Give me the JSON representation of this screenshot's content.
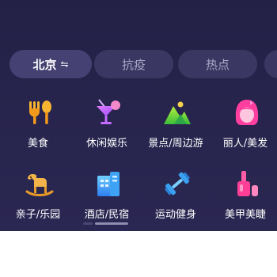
{
  "tabs": [
    {
      "label": "北京",
      "icon": "swap-arrows-icon",
      "arrow": "⇋"
    },
    {
      "label": "抗疫"
    },
    {
      "label": "热点"
    },
    {
      "label": ""
    }
  ],
  "categories": [
    {
      "label": "美食",
      "icon": "fork-spoon-icon"
    },
    {
      "label": "休闲娱乐",
      "icon": "cocktail-icon"
    },
    {
      "label": "景点/周边游",
      "icon": "mountain-icon"
    },
    {
      "label": "丽人/美发",
      "icon": "woman-face-icon"
    },
    {
      "label": "亲子/乐园",
      "icon": "rocking-horse-icon"
    },
    {
      "label": "酒店/民宿",
      "icon": "hotel-building-icon"
    },
    {
      "label": "运动健身",
      "icon": "dumbbell-icon"
    },
    {
      "label": "美甲美睫",
      "icon": "nail-polish-icon"
    }
  ],
  "colors": {
    "background": "#232145",
    "pill": "#3a3762",
    "pill_active": "#454172"
  }
}
